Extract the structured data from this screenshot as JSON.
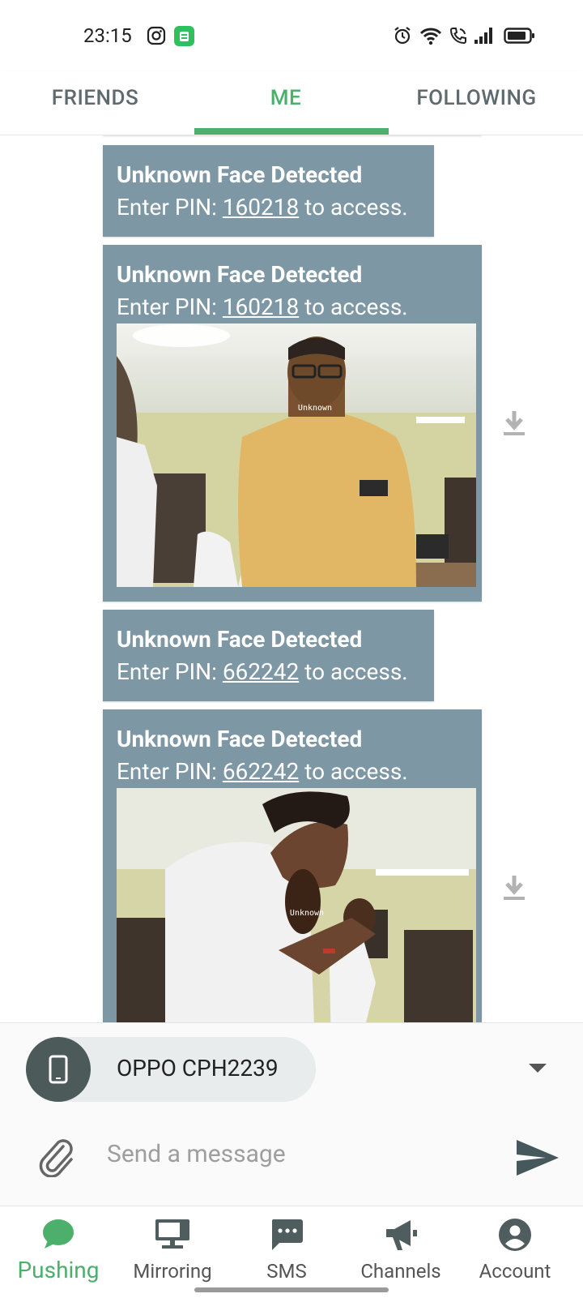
{
  "status_bar": {
    "time": "23:15",
    "icons": [
      "instagram-icon",
      "app-notification-icon",
      "alarm-icon",
      "wifi-icon",
      "wifi-call-icon",
      "signal-icon",
      "battery-icon"
    ]
  },
  "top_tabs": [
    {
      "label": "FRIENDS",
      "active": false
    },
    {
      "label": "ME",
      "active": true
    },
    {
      "label": "FOLLOWING",
      "active": false
    }
  ],
  "messages": [
    {
      "title": "Unknown Face Detected",
      "prefix": "Enter PIN: ",
      "pin": "160218",
      "suffix": " to access.",
      "has_image": false
    },
    {
      "title": "Unknown Face Detected",
      "prefix": "Enter PIN: ",
      "pin": "160218",
      "suffix": " to access.",
      "has_image": true,
      "image_caption": "Unknown"
    },
    {
      "title": "Unknown Face Detected",
      "prefix": "Enter PIN: ",
      "pin": "662242",
      "suffix": " to access.",
      "has_image": false
    },
    {
      "title": "Unknown Face Detected",
      "prefix": "Enter PIN: ",
      "pin": "662242",
      "suffix": " to access.",
      "has_image": true,
      "image_caption": "Unknown"
    }
  ],
  "device": {
    "name": "OPPO CPH2239",
    "icon": "smartphone-icon"
  },
  "composer": {
    "placeholder": "Send a message"
  },
  "bottom_nav": [
    {
      "label": "Pushing",
      "icon": "chat-bubble-icon",
      "active": true
    },
    {
      "label": "Mirroring",
      "icon": "monitor-icon",
      "active": false
    },
    {
      "label": "SMS",
      "icon": "sms-icon",
      "active": false
    },
    {
      "label": "Channels",
      "icon": "megaphone-icon",
      "active": false
    },
    {
      "label": "Account",
      "icon": "account-icon",
      "active": false
    }
  ],
  "colors": {
    "accent": "#4caf6b",
    "card": "#7e97a4",
    "device_avatar": "#4c5a5a"
  }
}
